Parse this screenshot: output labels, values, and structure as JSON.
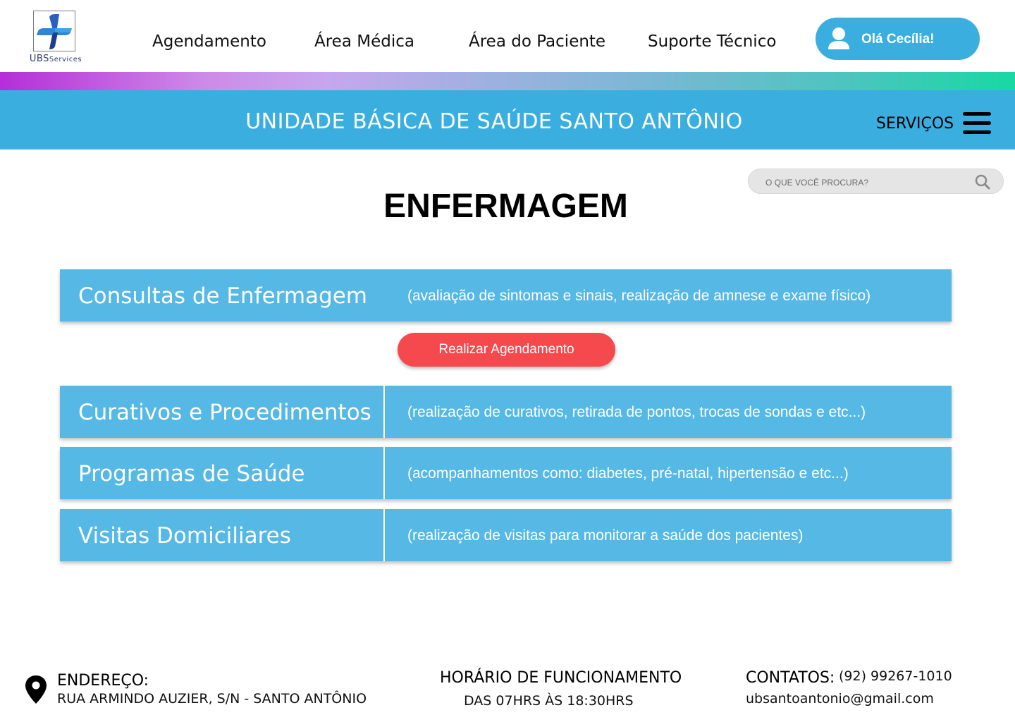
{
  "brand": {
    "logo_main": "UBS",
    "logo_sub": "ervices",
    "logo_cap": "S"
  },
  "nav": [
    {
      "label": "Agendamento"
    },
    {
      "label": "Área Médica"
    },
    {
      "label": "Área do Paciente"
    },
    {
      "label": "Suporte Técnico"
    }
  ],
  "user": {
    "greeting": "Olá Cecília!",
    "icon": "user-icon"
  },
  "banner": {
    "title": "UNIDADE BÁSICA DE SAÚDE SANTO ANTÔNIO",
    "services_label": "SERVIÇOS",
    "menu_icon": "hamburger-menu-icon"
  },
  "search": {
    "placeholder": "O QUE VOCÊ PROCURA?",
    "value": "",
    "icon": "search-icon"
  },
  "page": {
    "title": "ENFERMAGEM"
  },
  "services": [
    {
      "name": "Consultas de Enfermagem",
      "description": "(avaliação de sintomas e sinais, realização de amnese e exame físico)"
    },
    {
      "name": "Curativos e Procedimentos",
      "description": "(realização de curativos, retirada de pontos, trocas de sondas e etc...)"
    },
    {
      "name": "Programas de Saúde",
      "description": "(acompanhamentos como: diabetes, pré-natal, hipertensão e etc...)"
    },
    {
      "name": "Visitas Domiciliares",
      "description": "(realização de visitas para monitorar a saúde dos pacientes)"
    }
  ],
  "schedule_button": {
    "label": "Realizar Agendamento"
  },
  "footer": {
    "address_label": "ENDEREÇO:",
    "address": "RUA ARMINDO AUZIER, S/N - SANTO ANTÔNIO",
    "hours_label": "HORÁRIO DE FUNCIONAMENTO",
    "hours": "DAS 07HRS ÀS 18:30HRS",
    "contacts_label": "CONTATOS:",
    "phone": "(92) 99267-1010",
    "email": "ubsantoantonio@gmail.com"
  },
  "colors": {
    "primary_blue": "#3baee0",
    "row_blue": "#55b8e5",
    "button_red": "#f5494d"
  }
}
